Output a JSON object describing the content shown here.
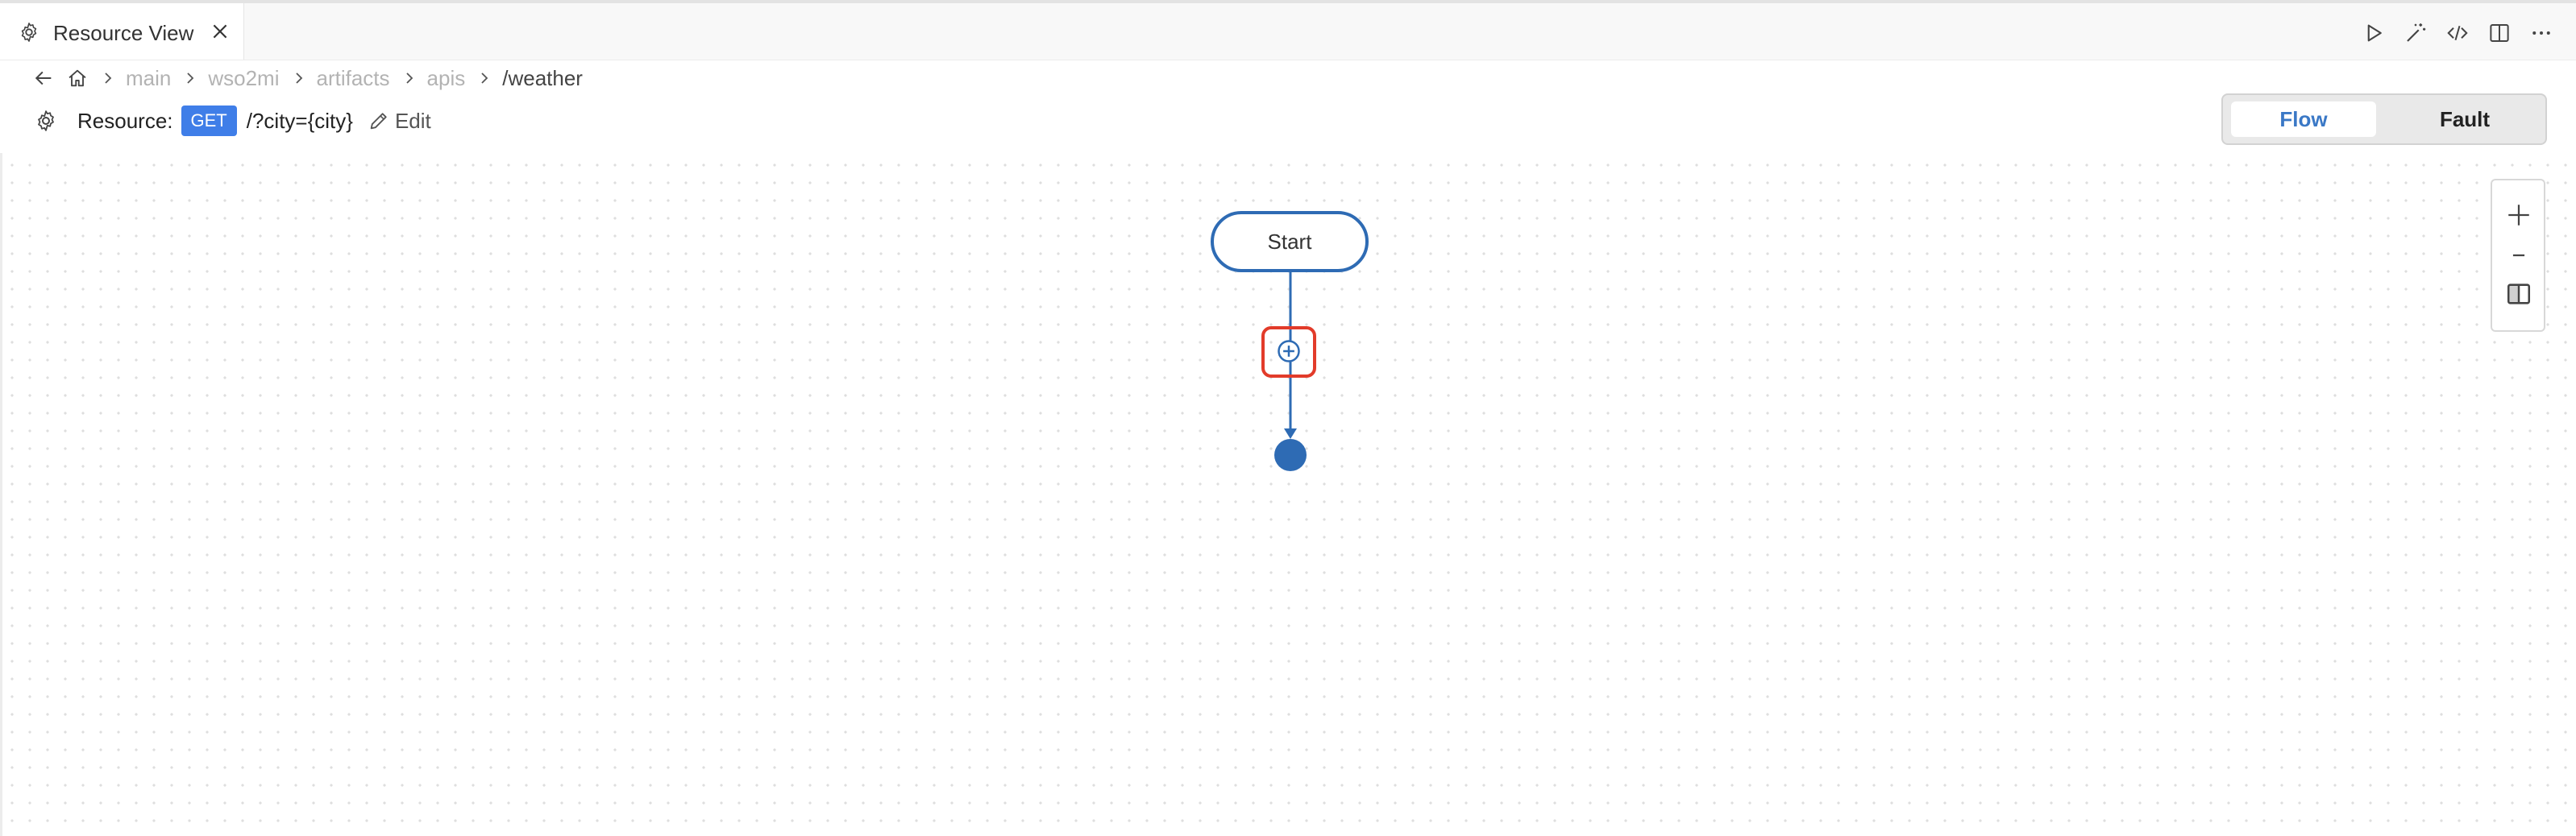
{
  "tab": {
    "title": "Resource View",
    "icon": "gear-icon",
    "close_icon": "close-icon"
  },
  "title_actions": [
    {
      "name": "run-icon"
    },
    {
      "name": "magic-wand-icon"
    },
    {
      "name": "code-icon"
    },
    {
      "name": "split-editor-icon"
    },
    {
      "name": "more-icon"
    }
  ],
  "breadcrumb": {
    "back_icon": "arrow-left-icon",
    "home_icon": "home-icon",
    "items": [
      "main",
      "wso2mi",
      "artifacts",
      "apis",
      "/weather"
    ]
  },
  "resource": {
    "label": "Resource:",
    "method": "GET",
    "path": "/?city={city}",
    "edit_label": "Edit"
  },
  "view_toggle": {
    "flow_label": "Flow",
    "fault_label": "Fault",
    "selected": "Flow"
  },
  "diagram": {
    "start_label": "Start"
  },
  "zoom_controls": [
    "zoom-in-icon",
    "zoom-out-icon",
    "fit-screen-icon"
  ],
  "colors": {
    "accent": "#2e6bb4",
    "method_badge": "#3f7ee8",
    "highlight": "#e23b2a"
  }
}
